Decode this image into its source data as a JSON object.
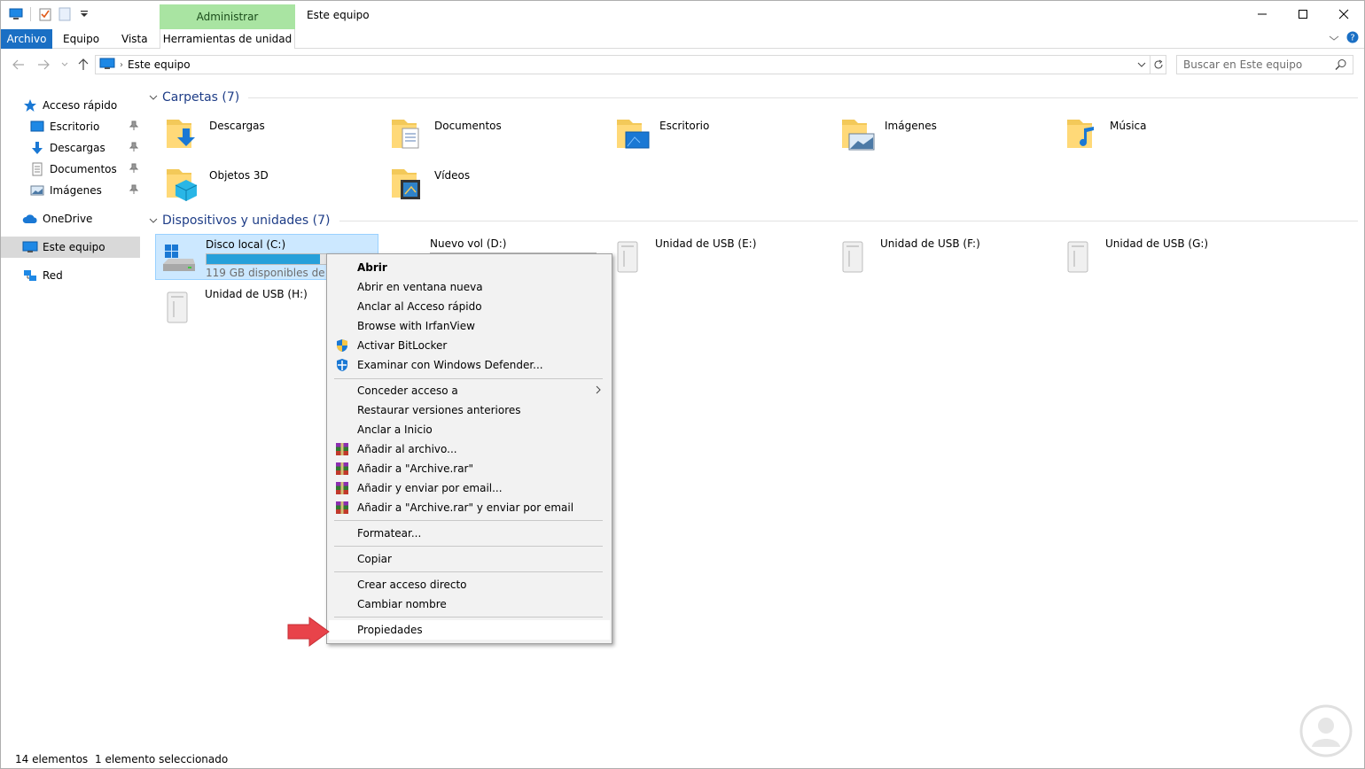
{
  "window": {
    "title": "Este equipo",
    "admin_tab": "Administrar",
    "controls": [
      "minimize-icon",
      "maximize-icon",
      "close-icon"
    ]
  },
  "ribbon": {
    "file_tab": "Archivo",
    "tabs": [
      "Equipo",
      "Vista"
    ],
    "contextual_tab": "Herramientas de unidad"
  },
  "nav": {
    "breadcrumb": "Este equipo",
    "search_placeholder": "Buscar en Este equipo"
  },
  "sidebar": {
    "quick_access": "Acceso rápido",
    "quick_items": [
      "Escritorio",
      "Descargas",
      "Documentos",
      "Imágenes"
    ],
    "onedrive": "OneDrive",
    "this_pc": "Este equipo",
    "network": "Red"
  },
  "content": {
    "folders_header": "Carpetas (7)",
    "folders": [
      "Descargas",
      "Documentos",
      "Escritorio",
      "Imágenes",
      "Música",
      "Objetos 3D",
      "Vídeos"
    ],
    "devices_header": "Dispositivos y unidades (7)",
    "drives": [
      {
        "name": "Disco local (C:)",
        "free": "119 GB disponibles de 389 GB",
        "used_fraction": 0.69
      },
      {
        "name": "Nuevo vol (D:)",
        "used_fraction": 0.82
      },
      {
        "name": "Unidad de USB (E:)"
      },
      {
        "name": "Unidad de USB (F:)"
      },
      {
        "name": "Unidad de USB (G:)"
      },
      {
        "name": "Unidad de USB (H:)"
      }
    ]
  },
  "context_menu": {
    "items": [
      {
        "label": "Abrir"
      },
      {
        "label": "Abrir en ventana nueva"
      },
      {
        "label": "Anclar al Acceso rápido"
      },
      {
        "label": "Browse with IrfanView"
      },
      {
        "label": "Activar BitLocker",
        "icon": "shield-icon"
      },
      {
        "label": "Examinar con Windows Defender...",
        "icon": "defender-icon"
      },
      {
        "label": "Conceder acceso a"
      },
      {
        "label": "Restaurar versiones anteriores"
      },
      {
        "label": "Anclar a Inicio"
      },
      {
        "label": "Añadir al archivo...",
        "icon": "winrar-icon"
      },
      {
        "label": "Añadir a \"Archive.rar\"",
        "icon": "winrar-icon"
      },
      {
        "label": "Añadir y enviar por email...",
        "icon": "winrar-icon"
      },
      {
        "label": "Añadir a \"Archive.rar\" y enviar por email",
        "icon": "winrar-icon"
      },
      {
        "label": "Formatear..."
      },
      {
        "label": "Copiar"
      },
      {
        "label": "Crear acceso directo"
      },
      {
        "label": "Cambiar nombre"
      },
      {
        "label": "Propiedades"
      }
    ]
  },
  "status": {
    "count": "14 elementos",
    "selection": "1 elemento seleccionado"
  },
  "colors": {
    "file_tab": "#1a6fc4",
    "admin_tab": "#a9e4a2",
    "selection": "#cce8ff",
    "drive_bar": "#26a0da",
    "group_title": "#1e3d87",
    "arrow": "#e8434a"
  }
}
